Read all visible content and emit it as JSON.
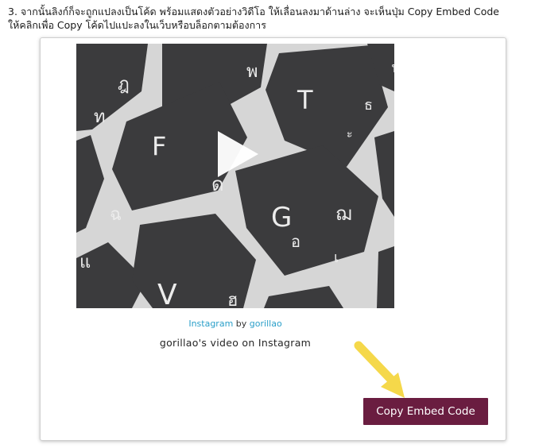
{
  "instruction": {
    "line1": "3. จากนั้นลิงก์ก็จะถูกแปลงเป็นโค้ด พร้อมแสดงตัวอย่างวิดีโอ ให้เลื่อนลงมาด้านล่าง จะเห็นปุ่ม Copy Embed Code",
    "line2": "ให้คลิกเพื่อ Copy โค้ดไปแปะลงในเว็บหรือบล็อกตามต้องการ"
  },
  "embed": {
    "keys": {
      "k1": "ฎ",
      "k2": "ท",
      "k3": "พ",
      "k4": "T",
      "k5": "ธ",
      "k6": "ะ",
      "k7": "F",
      "k8": "ด",
      "k9": "G",
      "k10": "ฌ",
      "k11": "เ",
      "k12": "ฉ",
      "k13": "แ",
      "k14": "V",
      "k15": "ฮ",
      "k16": "อ",
      "k17": "ฟ"
    },
    "platform_link": "Instagram",
    "by_text": "by",
    "author_link": "gorillao",
    "caption": "gorillao's video on Instagram",
    "copy_button_label": "Copy Embed Code"
  },
  "colors": {
    "button_bg": "#6a1d40",
    "link": "#2a9fc9",
    "arrow": "#f5d84a"
  }
}
